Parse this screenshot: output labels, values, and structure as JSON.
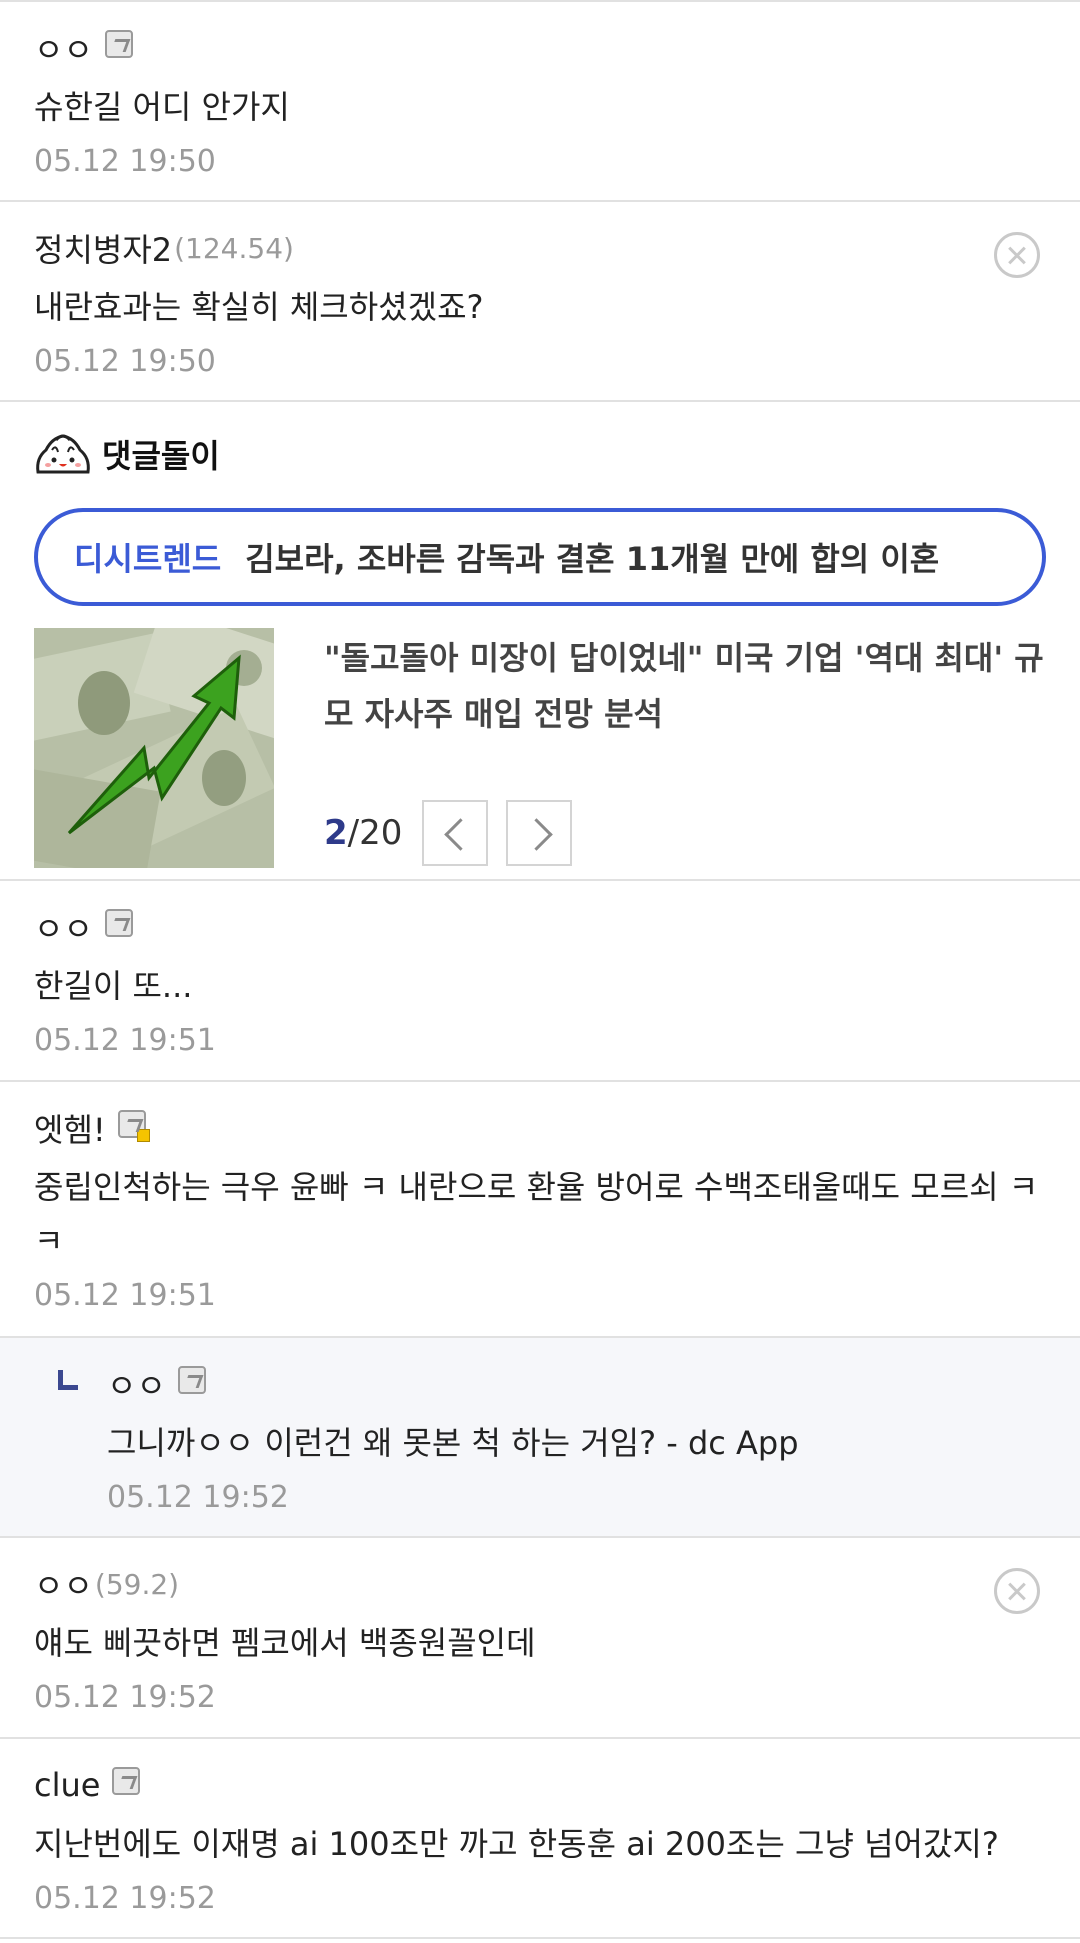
{
  "comments_top": [
    {
      "nickname": "ㅇㅇ",
      "ip": "",
      "text": "슈한길 어디 안가지",
      "date": "05.12 19:50",
      "badge": "fixed-nick",
      "deletable": false
    },
    {
      "nickname": "정치병자2",
      "ip": "(124.54)",
      "text": "내란효과는 확실히 체크하셨겠죠?",
      "date": "05.12 19:50",
      "badge": "",
      "deletable": true
    }
  ],
  "bot": {
    "name": "댓글돌이",
    "icon": "dumpling-bot-icon",
    "trend_tag": "디시트렌드",
    "trend_title": "김보라, 조바른 감독과 결혼 11개월 만에 합의 이혼",
    "news_title": "\"돌고돌아 미장이 답이었네\" 미국 기업 '역대 최대' 규모 자사주 매입 전망 분석",
    "thumbnail": "dollar-chart-thumbnail",
    "page_current": "2",
    "page_total": "/20"
  },
  "comments_bottom": [
    {
      "nickname": "ㅇㅇ",
      "ip": "",
      "text": "한길이 또...",
      "date": "05.12 19:51",
      "badge": "fixed-nick",
      "deletable": false,
      "reply": false
    },
    {
      "nickname": "엣헴!",
      "ip": "",
      "text": "중립인척하는 극우 윤빠 ㅋ 내란으로 환율 방어로 수백조태울때도 모르쇠 ㅋㅋ",
      "date": "05.12 19:51",
      "badge": "semi-fixed-nick",
      "deletable": false,
      "reply": false
    },
    {
      "nickname": "ㅇㅇ",
      "ip": "",
      "text": "그니까ㅇㅇ 이런건 왜 못본 척 하는 거임? - dc App",
      "date": "05.12 19:52",
      "badge": "fixed-nick",
      "deletable": false,
      "reply": true
    },
    {
      "nickname": "ㅇㅇ",
      "ip": "(59.2)",
      "text": "얘도 삐끗하면 펨코에서 백종원꼴인데",
      "date": "05.12 19:52",
      "badge": "",
      "deletable": true,
      "reply": false
    },
    {
      "nickname": "clue",
      "ip": "",
      "text": "지난번에도 이재명 ai 100조만 까고 한동훈 ai 200조는 그냥 넘어갔지?",
      "date": "05.12 19:52",
      "badge": "fixed-nick",
      "deletable": false,
      "reply": false
    }
  ],
  "colors": {
    "accent": "#3b5bd6",
    "reply_bg": "#f6f7fa",
    "date": "#9a9a9a",
    "page_current": "#2e3a8a"
  }
}
